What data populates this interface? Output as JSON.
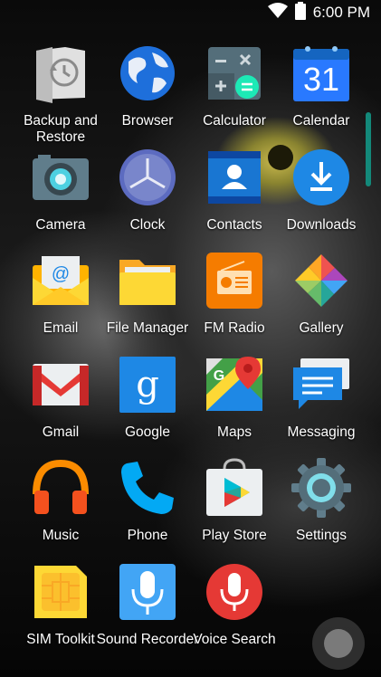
{
  "status_bar": {
    "time": "6:00 PM",
    "icons": [
      "wifi-icon",
      "battery-icon"
    ]
  },
  "apps": [
    {
      "label": "Backup and\nRestore",
      "icon": "backup-restore-icon"
    },
    {
      "label": "Browser",
      "icon": "browser-globe-icon"
    },
    {
      "label": "Calculator",
      "icon": "calculator-icon"
    },
    {
      "label": "Calendar",
      "icon": "calendar-icon",
      "calendar_day": "31"
    },
    {
      "label": "Camera",
      "icon": "camera-icon"
    },
    {
      "label": "Clock",
      "icon": "clock-icon"
    },
    {
      "label": "Contacts",
      "icon": "contacts-icon"
    },
    {
      "label": "Downloads",
      "icon": "download-icon"
    },
    {
      "label": "Email",
      "icon": "email-icon"
    },
    {
      "label": "File Manager",
      "icon": "folder-icon"
    },
    {
      "label": "FM Radio",
      "icon": "radio-icon"
    },
    {
      "label": "Gallery",
      "icon": "gallery-pinwheel-icon"
    },
    {
      "label": "Gmail",
      "icon": "gmail-icon"
    },
    {
      "label": "Google",
      "icon": "google-g-icon"
    },
    {
      "label": "Maps",
      "icon": "maps-icon"
    },
    {
      "label": "Messaging",
      "icon": "messaging-icon"
    },
    {
      "label": "Music",
      "icon": "headphones-icon"
    },
    {
      "label": "Phone",
      "icon": "phone-icon"
    },
    {
      "label": "Play Store",
      "icon": "play-store-icon"
    },
    {
      "label": "Settings",
      "icon": "settings-gear-icon"
    },
    {
      "label": "SIM Toolkit",
      "icon": "sim-card-icon"
    },
    {
      "label": "Sound Recorder",
      "icon": "microphone-icon"
    },
    {
      "label": "Voice Search",
      "icon": "voice-search-icon"
    }
  ],
  "colors": {
    "scroll_indicator": "#13897a",
    "background": "#050505"
  }
}
